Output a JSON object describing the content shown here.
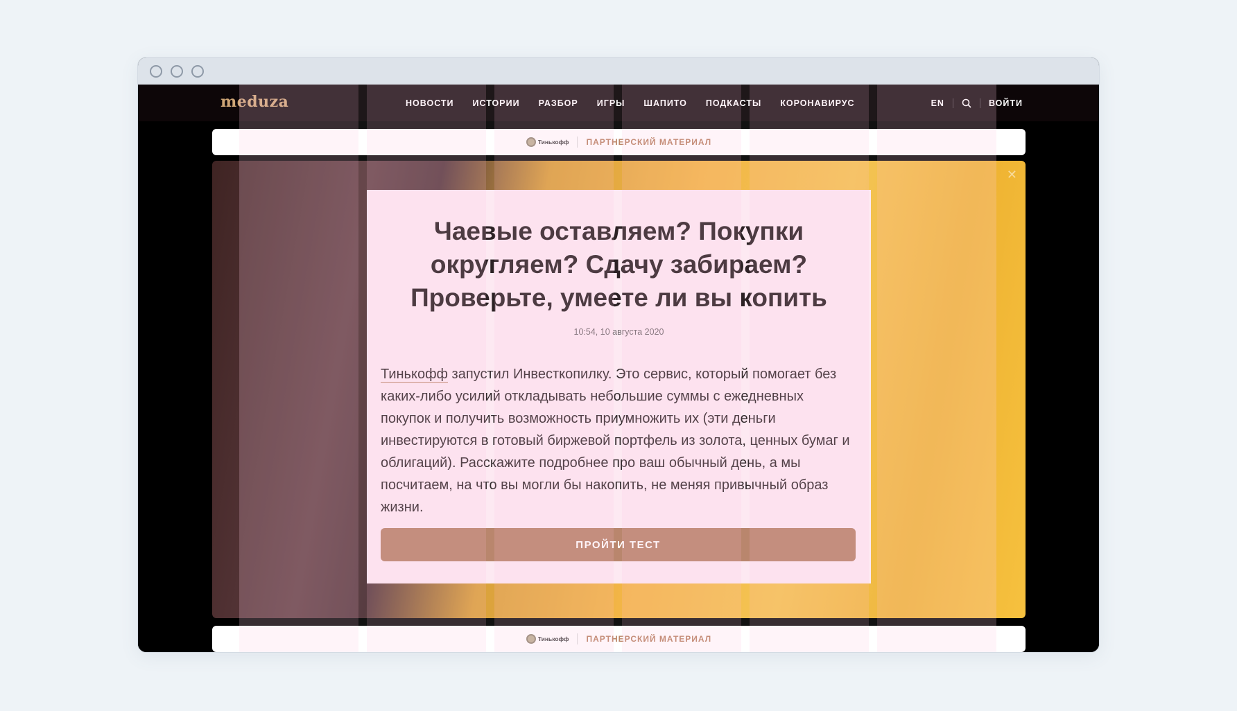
{
  "site": {
    "logo": "meduza"
  },
  "nav": {
    "items": [
      "НОВОСТИ",
      "ИСТОРИИ",
      "РАЗБОР",
      "ИГРЫ",
      "ШАПИТО",
      "ПОДКАСТЫ",
      "КОРОНАВИРУС"
    ],
    "lang": "EN",
    "login": "ВОЙТИ"
  },
  "partner_bar": {
    "brand": "Тинькофф",
    "label": "ПАРТНЕРСКИЙ МАТЕРИАЛ"
  },
  "article": {
    "title": "Чаевые оставляем? Покупки округляем? Сдачу забираем? Проверьте, умеете ли вы копить",
    "date": "10:54, 10 августа 2020",
    "link_text": "Тинькофф",
    "body": " запустил Инвесткопилку. Это сервис, который помогает без каких-либо усилий откладывать небольшие суммы с ежедневных покупок и получить возможность приумножить их (эти деньги инвестируются в готовый биржевой портфель из золота, ценных бумаг и облигаций). Расскажите подробнее про ваш обычный день, а мы посчитаем, на что вы могли бы накопить, не меняя привычный образ жизни.",
    "cta": "ПРОЙТИ ТЕСТ"
  },
  "colors": {
    "accent": "#b47d62",
    "card_bg": "#fde8f2",
    "logo": "#cfa676"
  }
}
